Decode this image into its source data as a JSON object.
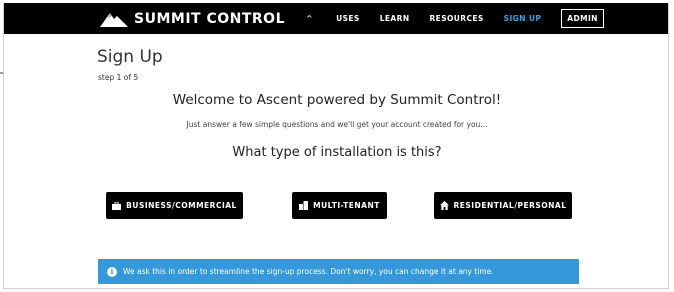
{
  "brand": {
    "name": "SUMMIT CONTROL",
    "logo_icon": "mountain-icon"
  },
  "nav": {
    "caret": "^",
    "items": [
      {
        "label": "USES"
      },
      {
        "label": "LEARN"
      },
      {
        "label": "RESOURCES"
      },
      {
        "label": "SIGN UP",
        "active": true
      }
    ],
    "admin_label": "ADMIN"
  },
  "page": {
    "title": "Sign Up",
    "step": "step 1 of 5",
    "welcome": "Welcome to Ascent powered by Summit Control!",
    "subtext": "Just answer a few simple questions and we'll get your account created for you...",
    "question": "What type of installation is this?"
  },
  "options": [
    {
      "label": "BUSINESS/COMMERCIAL",
      "icon": "briefcase-icon"
    },
    {
      "label": "MULTI-TENANT",
      "icon": "building-icon"
    },
    {
      "label": "RESIDENTIAL/PERSONAL",
      "icon": "home-icon"
    }
  ],
  "info": {
    "icon": "info-icon",
    "text": "We ask this in order to streamline the sign-up process. Don't worry, you can change it at any time."
  },
  "colors": {
    "topbar": "#000000",
    "active_nav": "#2fa4e7",
    "info_background": "#3498db",
    "button_background": "#000000"
  }
}
